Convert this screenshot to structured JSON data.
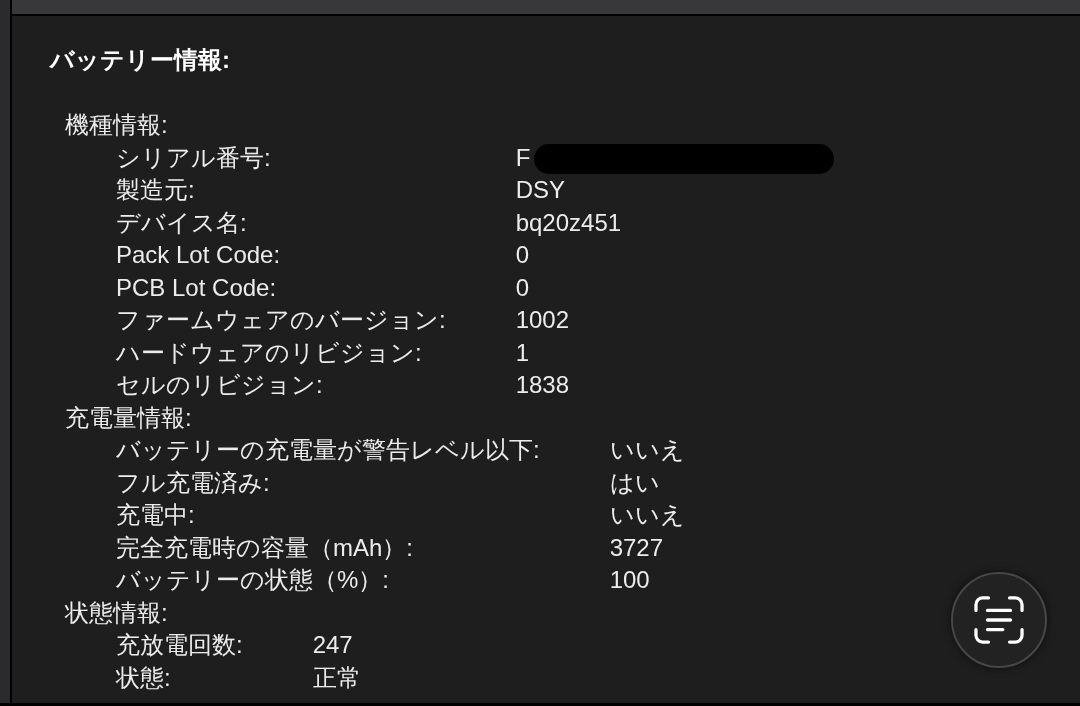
{
  "title": "バッテリー情報:",
  "sections": [
    {
      "heading": "機種情報:",
      "rows": [
        {
          "label": "シリアル番号:",
          "value": "F",
          "redacted": true
        },
        {
          "label": "製造元:",
          "value": "DSY"
        },
        {
          "label": "デバイス名:",
          "value": "bq20z451"
        },
        {
          "label": "Pack Lot Code:",
          "value": "0"
        },
        {
          "label": "PCB Lot Code:",
          "value": "0"
        },
        {
          "label": "ファームウェアのバージョン:",
          "value": "1002"
        },
        {
          "label": "ハードウェアのリビジョン:",
          "value": "1"
        },
        {
          "label": "セルのリビジョン:",
          "value": "1838"
        }
      ]
    },
    {
      "heading": "充電量情報:",
      "rows": [
        {
          "label": "バッテリーの充電量が警告レベル以下:",
          "value": "いいえ"
        },
        {
          "label": "フル充電済み:",
          "value": "はい"
        },
        {
          "label": "充電中:",
          "value": "いいえ"
        },
        {
          "label": "完全充電時の容量（mAh）:",
          "value": "3727"
        },
        {
          "label": "バッテリーの状態（%）:",
          "value": "100"
        }
      ]
    },
    {
      "heading": "状態情報:",
      "rows": [
        {
          "label": "充放電回数:",
          "value": "247"
        },
        {
          "label": "状態:",
          "value": "正常"
        }
      ]
    }
  ]
}
